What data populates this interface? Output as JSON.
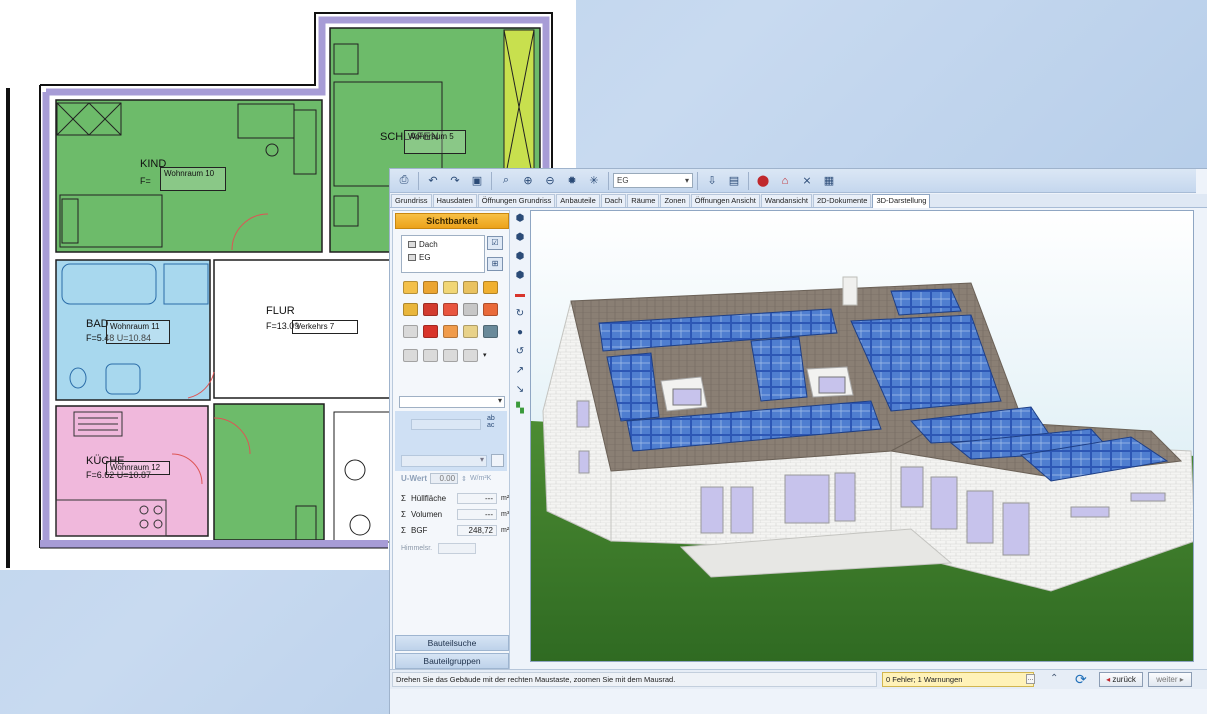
{
  "floorplan": {
    "rooms": [
      {
        "name": "KIND",
        "area": "F=",
        "tag": "Wohnraum 10"
      },
      {
        "name": "SCHLAFEN",
        "area": "",
        "tag": "Wohnraum 5"
      },
      {
        "name": "FLUR",
        "area": "F=13.09",
        "tag": "Verkehrs 7"
      },
      {
        "name": "BAD",
        "area": "F=5.48 U=10.84",
        "tag": "Wohnraum 11"
      },
      {
        "name": "KÜCHE",
        "area": "F=6.62 U=10.87",
        "tag": "Wohnraum 12"
      }
    ]
  },
  "toolbar": {
    "level_select": "EG",
    "icons": [
      "print-icon",
      "undo-icon",
      "redo-icon",
      "view-icon",
      "zoom-window-icon",
      "zoom-in-icon",
      "zoom-out-icon",
      "sun-icon",
      "light-icon",
      "import-icon",
      "folder-icon",
      "stop-icon",
      "roof-icon",
      "measure-icon",
      "snapshot-icon"
    ]
  },
  "tabs": [
    "Grundriss",
    "Hausdaten",
    "Öffnungen Grundriss",
    "Anbauteile",
    "Dach",
    "Räume",
    "Zonen",
    "Öffnungen Ansicht",
    "Wandansicht",
    "2D-Dokumente",
    "3D-Darstellung"
  ],
  "active_tab": "3D-Darstellung",
  "left_panel": {
    "sichtbarkeit_label": "Sichtbarkeit",
    "layers": [
      "Dach",
      "EG"
    ],
    "ab_label_top": "ab",
    "ab_label_bottom": "ac",
    "u_wert_label": "U-Wert",
    "u_wert_value": "0.00",
    "u_wert_unit": "W/m²K",
    "sums": [
      {
        "label": "Hüllfläche",
        "value": "---",
        "unit": "m²"
      },
      {
        "label": "Volumen",
        "value": "---",
        "unit": "m³"
      },
      {
        "label": "BGF",
        "value": "248,72",
        "unit": "m²"
      }
    ],
    "himmel_label": "Himmelsr.",
    "bauteilsuche_label": "Bauteilsuche",
    "bauteilgruppen_label": "Bauteilgruppen"
  },
  "status": {
    "hint": "Drehen Sie das Gebäude mit der rechten Maustaste, zoomen Sie mit dem Mausrad.",
    "messages": "0 Fehler; 1 Warnungen",
    "back_label": "zurück",
    "next_label": "weiter"
  },
  "colors": {
    "sichtbarkeit": "#eca21a",
    "room_green": "#6dbb6a",
    "room_blue": "#a8d8ee",
    "room_pink": "#f0b8dc",
    "grass": "#3f7d2c",
    "sky": "#c9e4ef",
    "roof": "#8a7f74",
    "solar": "#2d57b5"
  }
}
